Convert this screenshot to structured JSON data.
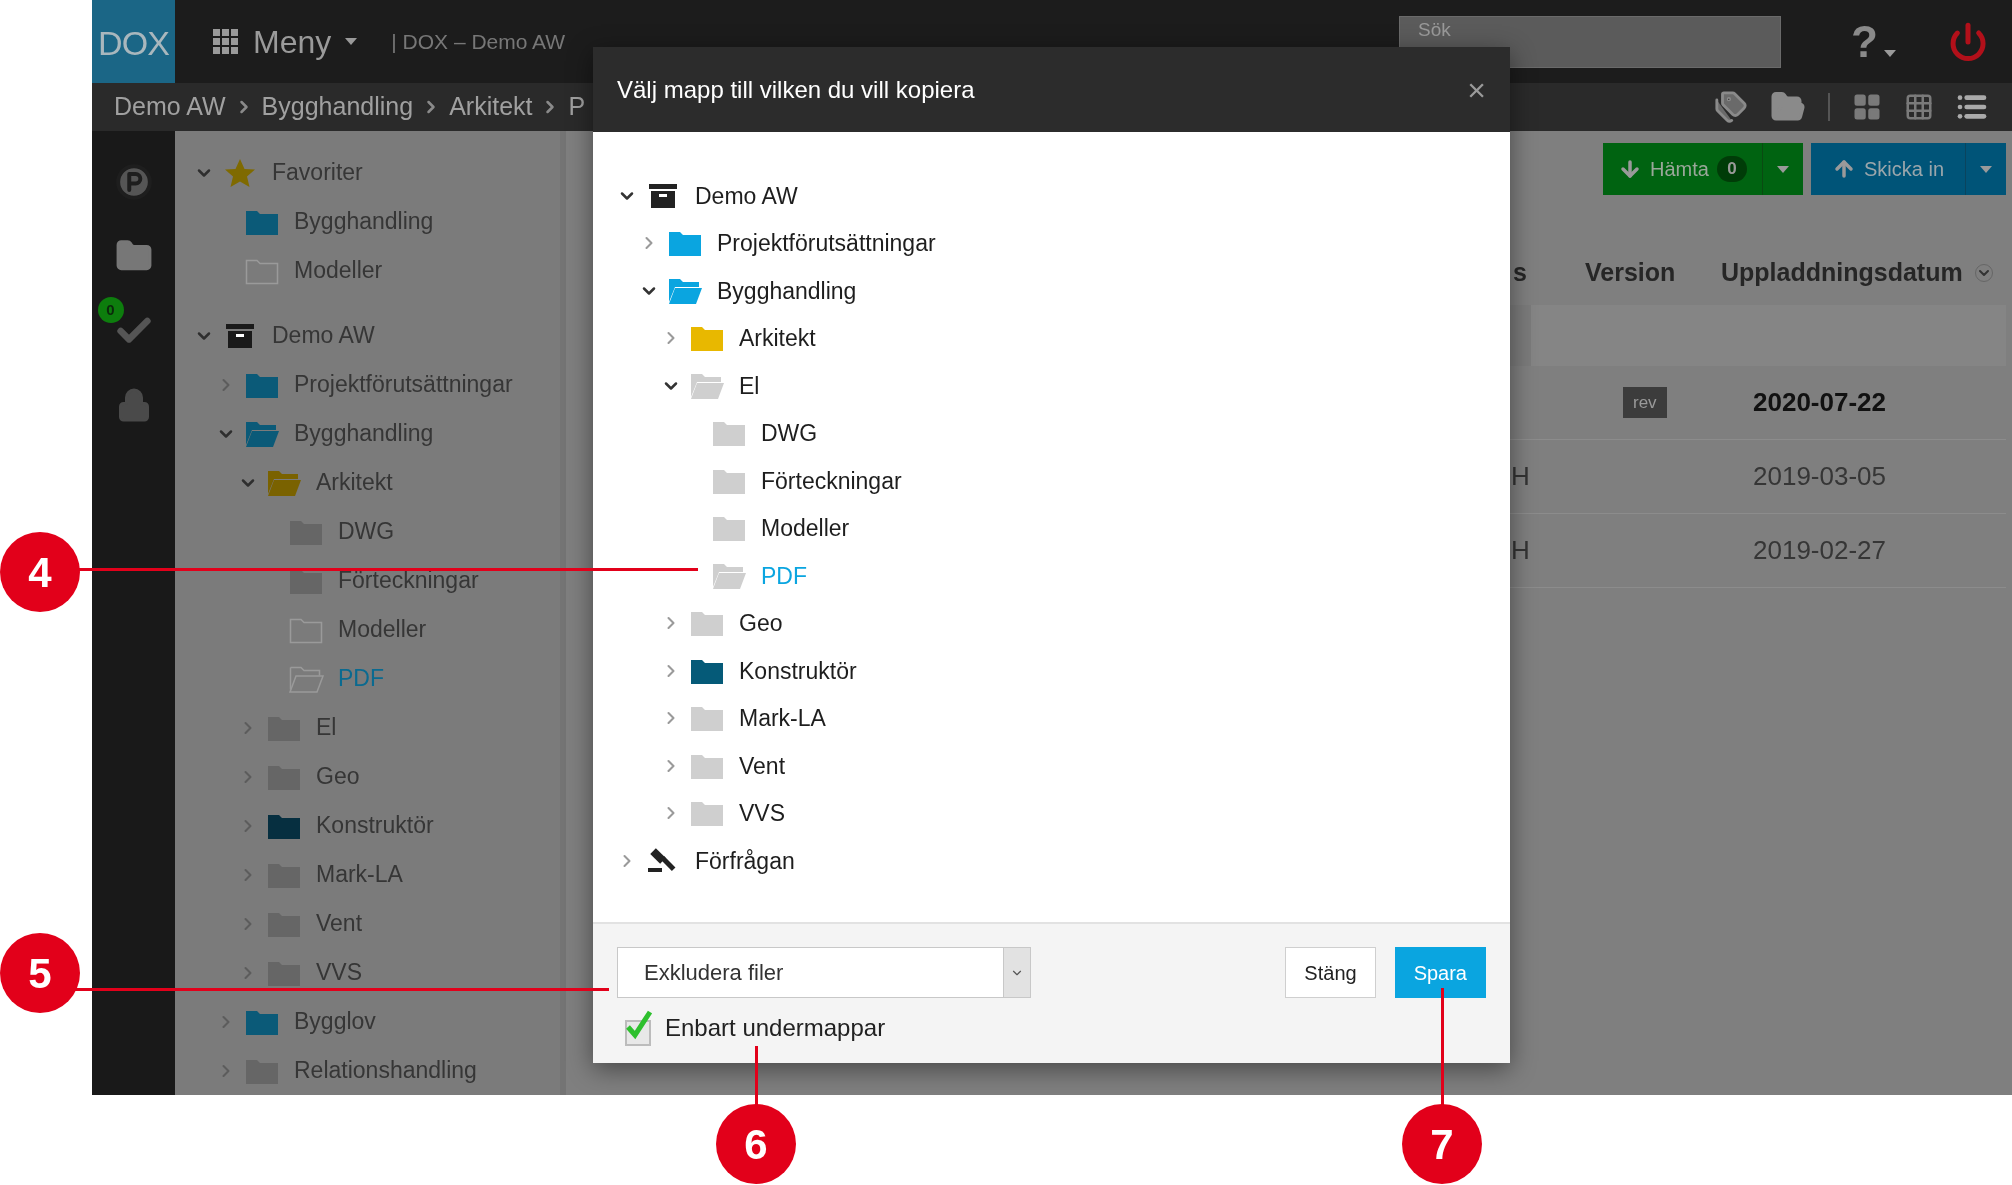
{
  "topbar": {
    "logo": "DOX",
    "menu_label": "Meny",
    "context": "| DOX – Demo AW",
    "search": {
      "placeholder": "Sök"
    },
    "help": "?"
  },
  "breadcrumb": [
    "Demo AW",
    "Bygghandling",
    "Arkitekt",
    "P"
  ],
  "side_strip": {
    "badge": "0"
  },
  "sidebar_tree": [
    {
      "label": "Favoriter",
      "kind": "star",
      "color": "#7f6a00",
      "expanded": true,
      "selected": false,
      "children": [
        {
          "label": "Bygghandling",
          "kind": "folder",
          "color": "#0b5a78",
          "selected": false
        },
        {
          "label": "Modeller",
          "kind": "folder-outline",
          "color": "#9a9a9a",
          "selected": false
        }
      ]
    },
    {
      "label": "Demo AW",
      "kind": "archive",
      "color": "#1a1a1a",
      "expanded": true,
      "selected": false,
      "children": [
        {
          "label": "Projektförutsättningar",
          "kind": "folder",
          "color": "#0b5a78",
          "expanded": false,
          "selected": false
        },
        {
          "label": "Bygghandling",
          "kind": "folder-open",
          "color": "#0b5a78",
          "expanded": true,
          "selected": false,
          "children": [
            {
              "label": "Arkitekt",
              "kind": "folder-open",
              "color": "#7a6200",
              "expanded": true,
              "selected": false,
              "children": [
                {
                  "label": "DWG",
                  "kind": "folder",
                  "color": "#666666",
                  "selected": false
                },
                {
                  "label": "Förteckningar",
                  "kind": "folder",
                  "color": "#666666",
                  "selected": false
                },
                {
                  "label": "Modeller",
                  "kind": "folder-outline",
                  "color": "#9a9a9a",
                  "selected": false
                },
                {
                  "label": "PDF",
                  "kind": "folder-open-outline",
                  "color": "#9a9a9a",
                  "selected": true
                }
              ]
            },
            {
              "label": "El",
              "kind": "folder",
              "color": "#666666",
              "expanded": false,
              "selected": false
            },
            {
              "label": "Geo",
              "kind": "folder",
              "color": "#666666",
              "expanded": false,
              "selected": false
            },
            {
              "label": "Konstruktör",
              "kind": "folder",
              "color": "#062f40",
              "expanded": false,
              "selected": false
            },
            {
              "label": "Mark-LA",
              "kind": "folder",
              "color": "#666666",
              "expanded": false,
              "selected": false
            },
            {
              "label": "Vent",
              "kind": "folder",
              "color": "#666666",
              "expanded": false,
              "selected": false
            },
            {
              "label": "VVS",
              "kind": "folder",
              "color": "#666666",
              "expanded": false,
              "selected": false
            }
          ]
        },
        {
          "label": "Bygglov",
          "kind": "folder",
          "color": "#0b5a78",
          "expanded": false,
          "selected": false
        },
        {
          "label": "Relationshandling",
          "kind": "folder",
          "color": "#666666",
          "expanded": false,
          "selected": false
        }
      ]
    }
  ],
  "actions": {
    "download": {
      "label": "Hämta",
      "count": "0"
    },
    "upload": {
      "label": "Skicka in"
    }
  },
  "table": {
    "columns": [
      "s",
      "Version",
      "Uppladdningsdatum"
    ],
    "rows": [
      {
        "version_tag": "rev",
        "date": "2020-07-22",
        "emphasized": true
      },
      {
        "column_1": "H",
        "date": "2019-03-05",
        "emphasized": false
      },
      {
        "column_1": "H",
        "date": "2019-02-27",
        "emphasized": false
      }
    ]
  },
  "modal": {
    "title": "Välj mapp till vilken du vill kopiera",
    "close": "×",
    "tree": [
      {
        "label": "Demo AW",
        "kind": "archive",
        "color": "#222222",
        "expanded": true,
        "selected": false,
        "children": [
          {
            "label": "Projektförutsättningar",
            "kind": "folder",
            "color": "#0aa5e0",
            "expanded": false,
            "selected": false
          },
          {
            "label": "Bygghandling",
            "kind": "folder-open",
            "color": "#0aa5e0",
            "expanded": true,
            "selected": false,
            "children": [
              {
                "label": "Arkitekt",
                "kind": "folder",
                "color": "#e8b800",
                "expanded": false,
                "selected": false
              },
              {
                "label": "El",
                "kind": "folder-open",
                "color": "#cfcfcf",
                "expanded": true,
                "selected": false,
                "children": [
                  {
                    "label": "DWG",
                    "kind": "folder",
                    "color": "#cfcfcf",
                    "selected": false
                  },
                  {
                    "label": "Förteckningar",
                    "kind": "folder",
                    "color": "#cfcfcf",
                    "selected": false
                  },
                  {
                    "label": "Modeller",
                    "kind": "folder",
                    "color": "#cfcfcf",
                    "selected": false
                  },
                  {
                    "label": "PDF",
                    "kind": "folder-open",
                    "color": "#cfcfcf",
                    "selected": true
                  }
                ]
              },
              {
                "label": "Geo",
                "kind": "folder",
                "color": "#cfcfcf",
                "expanded": false,
                "selected": false
              },
              {
                "label": "Konstruktör",
                "kind": "folder",
                "color": "#055a78",
                "expanded": false,
                "selected": false
              },
              {
                "label": "Mark-LA",
                "kind": "folder",
                "color": "#cfcfcf",
                "expanded": false,
                "selected": false
              },
              {
                "label": "Vent",
                "kind": "folder",
                "color": "#cfcfcf",
                "expanded": false,
                "selected": false
              },
              {
                "label": "VVS",
                "kind": "folder",
                "color": "#cfcfcf",
                "expanded": false,
                "selected": false
              }
            ]
          }
        ]
      },
      {
        "label": "Förfrågan",
        "kind": "gavel",
        "color": "#222222",
        "expanded": false,
        "selected": false
      }
    ],
    "filter": {
      "value": "Exkludera filer"
    },
    "checkbox": {
      "label": "Enbart undermappar",
      "checked": true
    },
    "buttons": [
      {
        "label": "Stäng",
        "kind": "secondary"
      },
      {
        "label": "Spara",
        "kind": "primary"
      }
    ]
  },
  "callouts": [
    {
      "number": "4"
    },
    {
      "number": "5"
    },
    {
      "number": "6"
    },
    {
      "number": "7"
    }
  ]
}
